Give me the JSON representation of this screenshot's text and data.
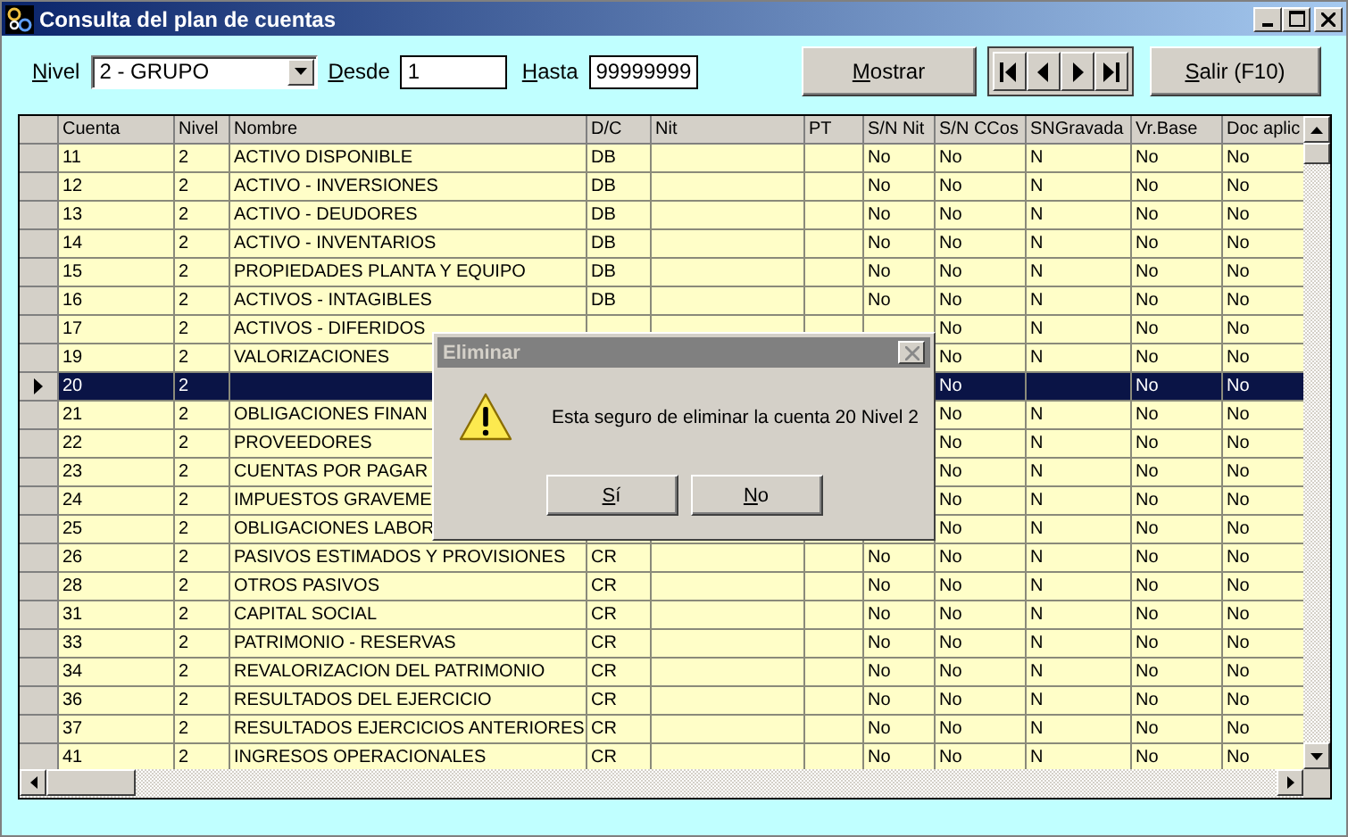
{
  "window": {
    "title": "Consulta del plan de cuentas"
  },
  "filters": {
    "nivel_label": "Nivel",
    "nivel_value": "2 - GRUPO",
    "desde_label": "Desde",
    "desde_value": "1",
    "hasta_label": "Hasta",
    "hasta_value": "99999999"
  },
  "buttons": {
    "mostrar": "Mostrar",
    "salir": "Salir (F10)"
  },
  "table": {
    "columns": [
      "Cuenta",
      "Nivel",
      "Nombre",
      "D/C",
      "Nit",
      "PT",
      "S/N Nit",
      "S/N CCos",
      "SNGravada",
      "Vr.Base",
      "Doc aplic"
    ],
    "rows": [
      {
        "cuenta": "11",
        "nivel": "2",
        "nombre": "ACTIVO DISPONIBLE",
        "dc": "DB",
        "sn_nit": "No",
        "sn_ccos": "No",
        "sngravada": "N",
        "vr_base": "No",
        "doc_aplica": "No",
        "selected": false
      },
      {
        "cuenta": "12",
        "nivel": "2",
        "nombre": "ACTIVO - INVERSIONES",
        "dc": "DB",
        "sn_nit": "No",
        "sn_ccos": "No",
        "sngravada": "N",
        "vr_base": "No",
        "doc_aplica": "No",
        "selected": false
      },
      {
        "cuenta": "13",
        "nivel": "2",
        "nombre": "ACTIVO - DEUDORES",
        "dc": "DB",
        "sn_nit": "No",
        "sn_ccos": "No",
        "sngravada": "N",
        "vr_base": "No",
        "doc_aplica": "No",
        "selected": false
      },
      {
        "cuenta": "14",
        "nivel": "2",
        "nombre": "ACTIVO - INVENTARIOS",
        "dc": "DB",
        "sn_nit": "No",
        "sn_ccos": "No",
        "sngravada": "N",
        "vr_base": "No",
        "doc_aplica": "No",
        "selected": false
      },
      {
        "cuenta": "15",
        "nivel": "2",
        "nombre": "PROPIEDADES PLANTA Y EQUIPO",
        "dc": "DB",
        "sn_nit": "No",
        "sn_ccos": "No",
        "sngravada": "N",
        "vr_base": "No",
        "doc_aplica": "No",
        "selected": false
      },
      {
        "cuenta": "16",
        "nivel": "2",
        "nombre": "ACTIVOS - INTAGIBLES",
        "dc": "DB",
        "sn_nit": "No",
        "sn_ccos": "No",
        "sngravada": "N",
        "vr_base": "No",
        "doc_aplica": "No",
        "selected": false
      },
      {
        "cuenta": "17",
        "nivel": "2",
        "nombre": "ACTIVOS - DIFERIDOS",
        "sn_ccos": "No",
        "sngravada": "N",
        "vr_base": "No",
        "doc_aplica": "No",
        "selected": false
      },
      {
        "cuenta": "19",
        "nivel": "2",
        "nombre": "VALORIZACIONES",
        "sn_ccos": "No",
        "sngravada": "N",
        "vr_base": "No",
        "doc_aplica": "No",
        "selected": false
      },
      {
        "cuenta": "20",
        "nivel": "2",
        "sn_ccos": "No",
        "vr_base": "No",
        "doc_aplica": "No",
        "selected": true
      },
      {
        "cuenta": "21",
        "nivel": "2",
        "nombre": "OBLIGACIONES FINAN",
        "sn_ccos": "No",
        "sngravada": "N",
        "vr_base": "No",
        "doc_aplica": "No",
        "selected": false
      },
      {
        "cuenta": "22",
        "nivel": "2",
        "nombre": "PROVEEDORES",
        "sn_ccos": "No",
        "sngravada": "N",
        "vr_base": "No",
        "doc_aplica": "No",
        "selected": false
      },
      {
        "cuenta": "23",
        "nivel": "2",
        "nombre": "CUENTAS POR PAGAR",
        "sn_ccos": "No",
        "sngravada": "N",
        "vr_base": "No",
        "doc_aplica": "No",
        "selected": false
      },
      {
        "cuenta": "24",
        "nivel": "2",
        "nombre": "IMPUESTOS GRAVEME",
        "sn_ccos": "No",
        "sngravada": "N",
        "vr_base": "No",
        "doc_aplica": "No",
        "selected": false
      },
      {
        "cuenta": "25",
        "nivel": "2",
        "nombre": "OBLIGACIONES LABOR",
        "sn_ccos": "No",
        "sngravada": "N",
        "vr_base": "No",
        "doc_aplica": "No",
        "selected": false
      },
      {
        "cuenta": "26",
        "nivel": "2",
        "nombre": "PASIVOS ESTIMADOS Y PROVISIONES",
        "dc": "CR",
        "sn_nit": "No",
        "sn_ccos": "No",
        "sngravada": "N",
        "vr_base": "No",
        "doc_aplica": "No",
        "selected": false
      },
      {
        "cuenta": "28",
        "nivel": "2",
        "nombre": "OTROS PASIVOS",
        "dc": "CR",
        "sn_nit": "No",
        "sn_ccos": "No",
        "sngravada": "N",
        "vr_base": "No",
        "doc_aplica": "No",
        "selected": false
      },
      {
        "cuenta": "31",
        "nivel": "2",
        "nombre": "CAPITAL SOCIAL",
        "dc": "CR",
        "sn_nit": "No",
        "sn_ccos": "No",
        "sngravada": "N",
        "vr_base": "No",
        "doc_aplica": "No",
        "selected": false
      },
      {
        "cuenta": "33",
        "nivel": "2",
        "nombre": "PATRIMONIO - RESERVAS",
        "dc": "CR",
        "sn_nit": "No",
        "sn_ccos": "No",
        "sngravada": "N",
        "vr_base": "No",
        "doc_aplica": "No",
        "selected": false
      },
      {
        "cuenta": "34",
        "nivel": "2",
        "nombre": "REVALORIZACION DEL PATRIMONIO",
        "dc": "CR",
        "sn_nit": "No",
        "sn_ccos": "No",
        "sngravada": "N",
        "vr_base": "No",
        "doc_aplica": "No",
        "selected": false
      },
      {
        "cuenta": "36",
        "nivel": "2",
        "nombre": "RESULTADOS DEL EJERCICIO",
        "dc": "CR",
        "sn_nit": "No",
        "sn_ccos": "No",
        "sngravada": "N",
        "vr_base": "No",
        "doc_aplica": "No",
        "selected": false
      },
      {
        "cuenta": "37",
        "nivel": "2",
        "nombre": "RESULTADOS EJERCICIOS ANTERIORES",
        "dc": "CR",
        "sn_nit": "No",
        "sn_ccos": "No",
        "sngravada": "N",
        "vr_base": "No",
        "doc_aplica": "No",
        "selected": false
      },
      {
        "cuenta": "41",
        "nivel": "2",
        "nombre": "INGRESOS OPERACIONALES",
        "dc": "CR",
        "sn_nit": "No",
        "sn_ccos": "No",
        "sngravada": "N",
        "vr_base": "No",
        "doc_aplica": "No",
        "selected": false
      }
    ]
  },
  "dialog": {
    "title": "Eliminar",
    "message": "Esta seguro de eliminar la cuenta 20 Nivel 2",
    "buttons": [
      "Sí",
      "No"
    ]
  }
}
